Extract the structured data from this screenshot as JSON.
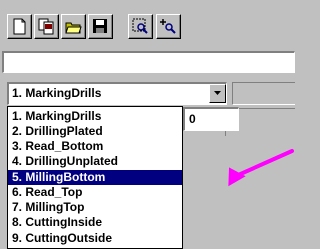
{
  "toolbar": {
    "buttons": [
      {
        "icon": "new-document-icon"
      },
      {
        "icon": "copy-document-icon"
      },
      {
        "icon": "open-folder-icon"
      },
      {
        "icon": "save-floppy-icon"
      },
      {
        "icon": "zoom-window-icon"
      },
      {
        "icon": "zoom-in-icon"
      }
    ]
  },
  "path_field": {
    "value": ""
  },
  "layer_select": {
    "selected": "1. MarkingDrills",
    "options": [
      "1. MarkingDrills",
      "2. DrillingPlated",
      "3. Read_Bottom",
      "4. DrillingUnplated",
      "5. MillingBottom",
      "6. Read_Top",
      "7. MillingTop",
      "8. CuttingInside",
      "9. CuttingOutside"
    ],
    "highlighted_index": 4,
    "highlight_color": "#000080"
  },
  "value_cell": {
    "value": "0"
  },
  "annotation": {
    "arrow_color": "#ff00ff"
  }
}
